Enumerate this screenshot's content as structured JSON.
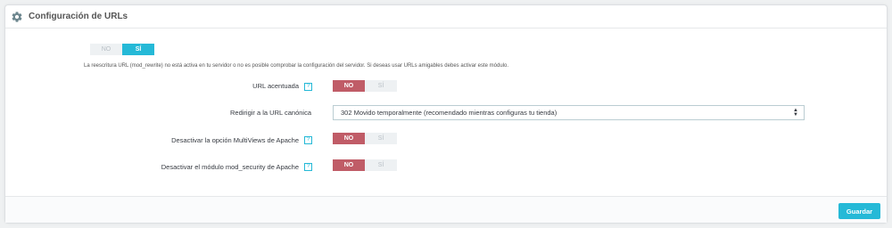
{
  "panel": {
    "title": "Configuración de URLs",
    "icon": "gear-icon"
  },
  "rewrite_switch": {
    "no_label": "NO",
    "yes_label": "SÍ",
    "selected": "yes"
  },
  "rewrite_help": "La reescritura URL (mod_rewrite) no está activa en tu servidor o no es posible comprobar la configuración del servidor. Si deseas usar URLs amigables debes activar este módulo.",
  "fields": {
    "accented_url": {
      "label": "URL acentuada",
      "help_icon": "?",
      "no_label": "NO",
      "yes_label": "SÍ",
      "selected": "no"
    },
    "canonical_redirect": {
      "label": "Redirigir a la URL canónica",
      "value": "302 Movido temporalmente (recomendado mientras configuras tu tienda)"
    },
    "multiviews": {
      "label": "Desactivar la opción MultiViews de Apache",
      "help_icon": "?",
      "no_label": "NO",
      "yes_label": "SÍ",
      "selected": "no"
    },
    "mod_security": {
      "label": "Desactivar el módulo mod_security de Apache",
      "help_icon": "?",
      "no_label": "NO",
      "yes_label": "SÍ",
      "selected": "no"
    }
  },
  "footer": {
    "save_label": "Guardar"
  },
  "colors": {
    "accent": "#25b9d7",
    "no_active": "#c05c67",
    "inactive": "#eef1f3"
  }
}
